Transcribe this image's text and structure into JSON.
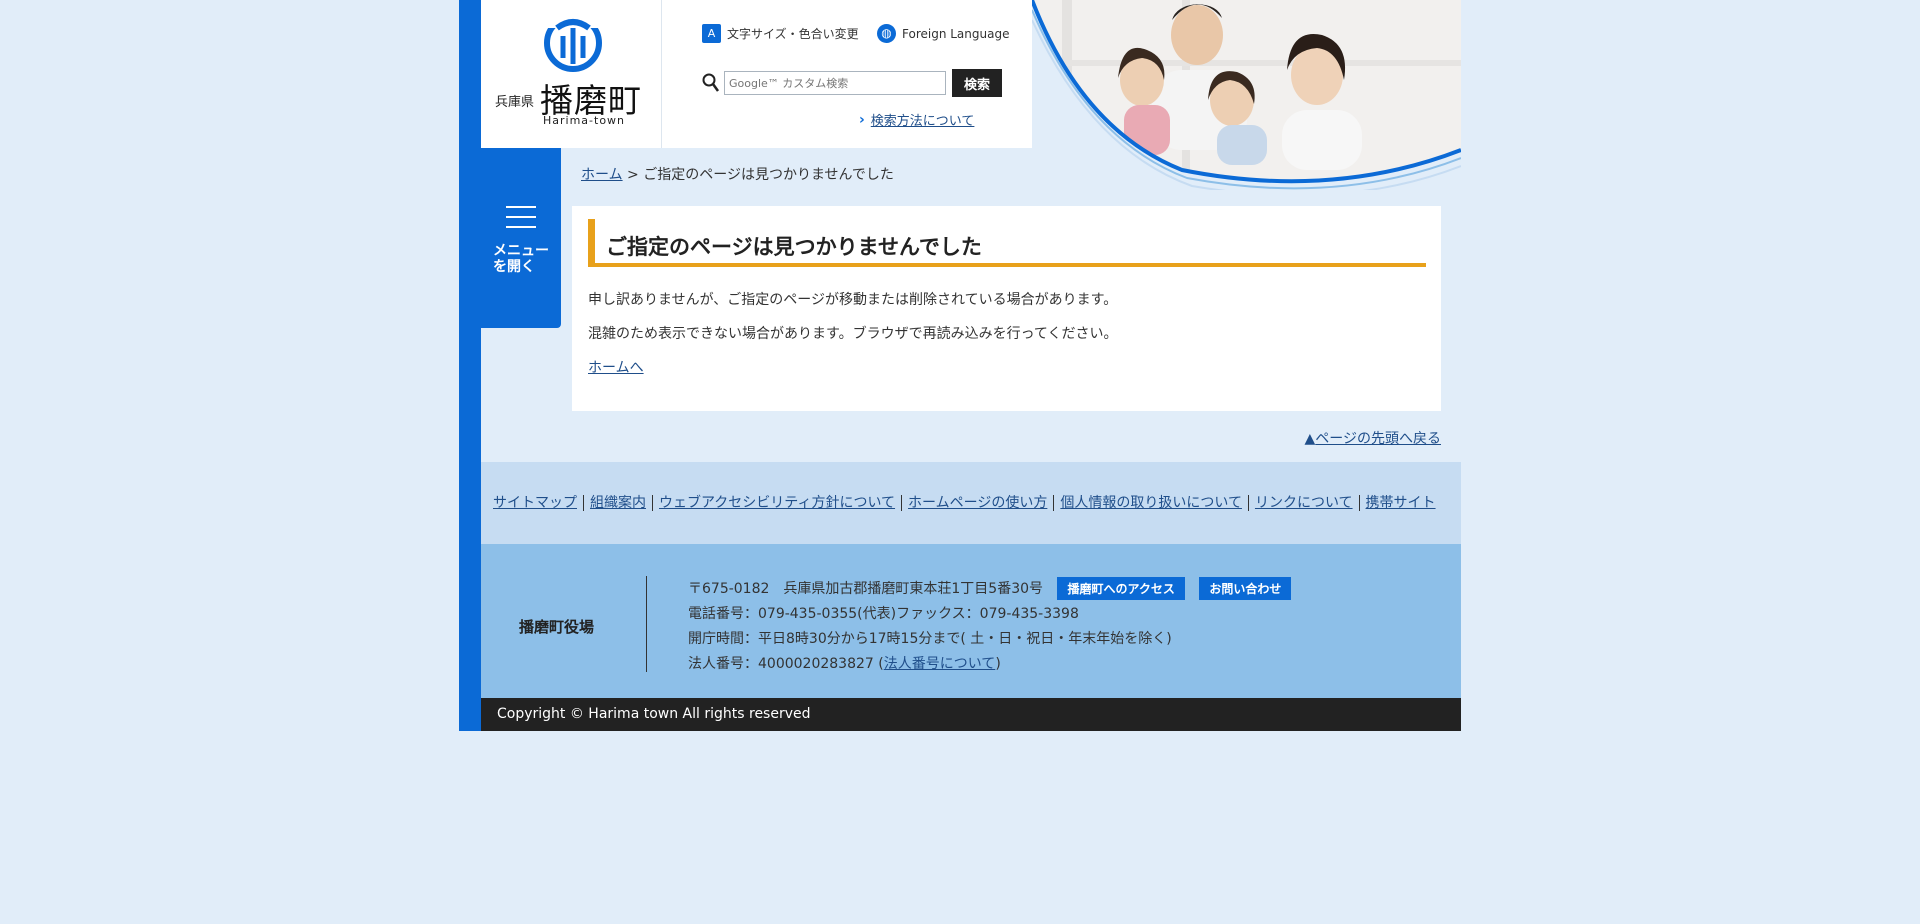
{
  "header": {
    "logo_pref": "兵庫県",
    "logo_town": "播磨町",
    "logo_en": "Harima-town",
    "text_size_link": "文字サイズ・色合い変更",
    "text_size_icon": "A",
    "foreign_language_link": "Foreign Language",
    "search_placeholder": "Google™ カスタム検索",
    "search_button": "検索",
    "search_howto": "検索方法について",
    "photo_icon": "family-photo"
  },
  "menu": {
    "label": "メニュー\nを開く"
  },
  "breadcrumb": {
    "home": "ホーム",
    "separator": ">",
    "current": "ご指定のページは見つかりませんでした"
  },
  "main": {
    "title": "ご指定のページは見つかりませんでした",
    "line1": "申し訳ありませんが、ご指定のページが移動または削除されている場合があります。",
    "line2": "混雑のため表示できない場合があります。ブラウザで再読み込みを行ってください。",
    "home_link": "ホームへ",
    "to_top": "ページの先頭へ戻る",
    "to_top_marker": "▲"
  },
  "footer_links": [
    "サイトマップ",
    "組織案内",
    "ウェブアクセシビリティ方針について",
    "ホームページの使い方",
    "個人情報の取り扱いについて",
    "リンクについて",
    "携帯サイト"
  ],
  "office": {
    "name": "播磨町役場",
    "address": "〒675-0182　兵庫県加古郡播磨町東本荘1丁目5番30号",
    "access_button": "播磨町へのアクセス",
    "contact_button": "お問い合わせ",
    "phone": "電話番号：079-435-0355(代表)ファックス：079-435-3398",
    "hours": "開庁時間：平日8時30分から17時15分まで( 土・日・祝日・年末年始を除く)",
    "corp_number": "法人番号：4000020283827 (",
    "corp_number_link": "法人番号について",
    "corp_number_close": ")"
  },
  "copyright": "Copyright © Harima town All rights reserved",
  "colors": {
    "brand_blue": "#0b6ad6",
    "accent_orange": "#e8a11b",
    "page_bg": "#e1edf9"
  }
}
